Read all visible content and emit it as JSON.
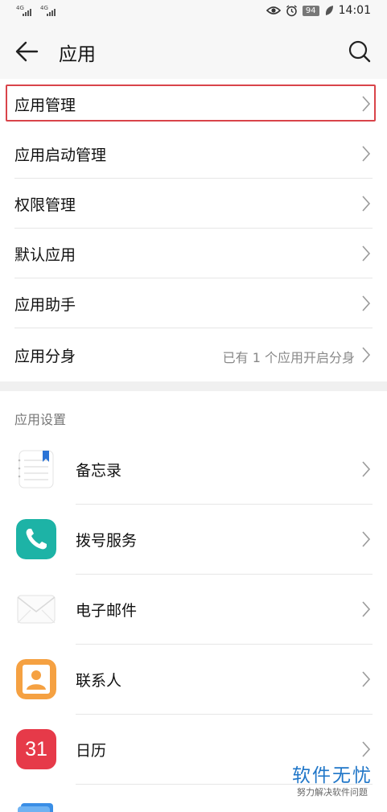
{
  "status_bar": {
    "sim1": "4G",
    "sim2": "4G",
    "battery": "94",
    "time": "14:01"
  },
  "app_bar": {
    "title": "应用"
  },
  "menu": {
    "items": [
      {
        "label": "应用管理",
        "value": "",
        "highlighted": true
      },
      {
        "label": "应用启动管理",
        "value": ""
      },
      {
        "label": "权限管理",
        "value": ""
      },
      {
        "label": "默认应用",
        "value": ""
      },
      {
        "label": "应用助手",
        "value": ""
      },
      {
        "label": "应用分身",
        "value": "已有 1 个应用开启分身"
      }
    ]
  },
  "app_settings": {
    "header": "应用设置",
    "apps": [
      {
        "label": "备忘录",
        "icon": "notepad-icon"
      },
      {
        "label": "拨号服务",
        "icon": "phone-icon"
      },
      {
        "label": "电子邮件",
        "icon": "email-icon"
      },
      {
        "label": "联系人",
        "icon": "contacts-icon"
      },
      {
        "label": "日历",
        "icon": "calendar-icon",
        "icon_text": "31"
      }
    ]
  },
  "watermark": {
    "main": "软件无忧",
    "sub": "努力解决软件问题"
  },
  "colors": {
    "highlight_border": "#d9444a",
    "watermark": "#1f76c8"
  }
}
